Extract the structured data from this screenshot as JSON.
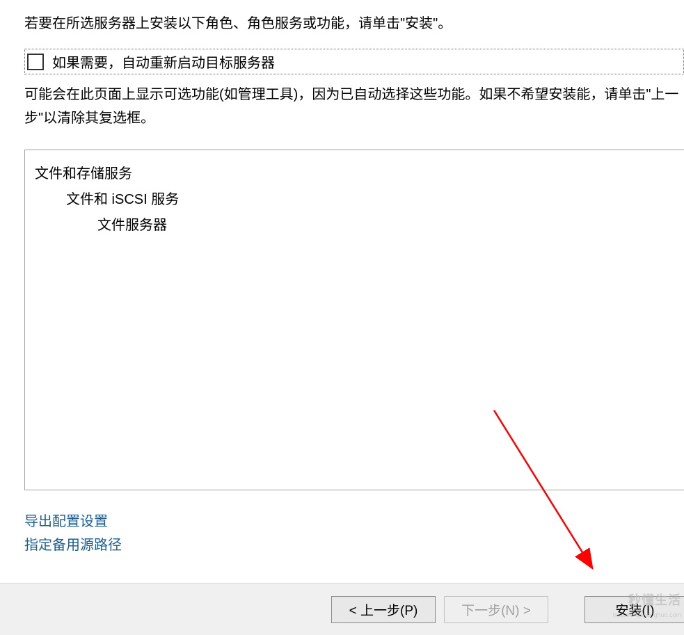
{
  "instruction": "若要在所选服务器上安装以下角色、角色服务或功能，请单击\"安装\"。",
  "checkbox": {
    "label": "如果需要，自动重新启动目标服务器",
    "checked": false
  },
  "description": "可能会在此页面上显示可选功能(如管理工具)，因为已自动选择这些功能。如果不希望安装能，请单击\"上一步\"以清除其复选框。",
  "tree": {
    "items": [
      {
        "level": 1,
        "label": "文件和存储服务"
      },
      {
        "level": 2,
        "label": "文件和 iSCSI 服务"
      },
      {
        "level": 3,
        "label": "文件服务器"
      }
    ]
  },
  "links": {
    "export_config": "导出配置设置",
    "alt_source_path": "指定备用源路径"
  },
  "buttons": {
    "previous": "< 上一步(P)",
    "next": "下一步(N) >",
    "install": "安装(I)"
  },
  "watermark": {
    "main": "秒懂生活",
    "sub": "miaodongshenghuo.com"
  }
}
